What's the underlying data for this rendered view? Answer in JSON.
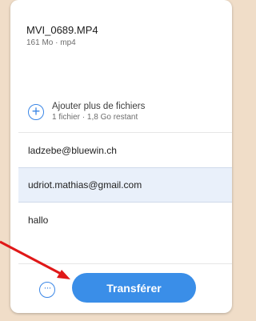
{
  "file": {
    "name": "MVI_0689.MP4",
    "meta": "161 Mo · mp4"
  },
  "add_files": {
    "icon": "plus-circle-icon",
    "label": "Ajouter plus de fichiers",
    "sub": "1 fichier · 1,8 Go restant"
  },
  "form": {
    "email_from": "ladzebe@bluewin.ch",
    "email_to": "udriot.mathias@gmail.com",
    "message": "hallo"
  },
  "footer": {
    "more_icon": "ellipsis-circle-icon",
    "transfer_label": "Transférer"
  },
  "colors": {
    "accent": "#3a8ee8",
    "annotation": "#e01818",
    "backdrop": "#f0ddc8"
  }
}
